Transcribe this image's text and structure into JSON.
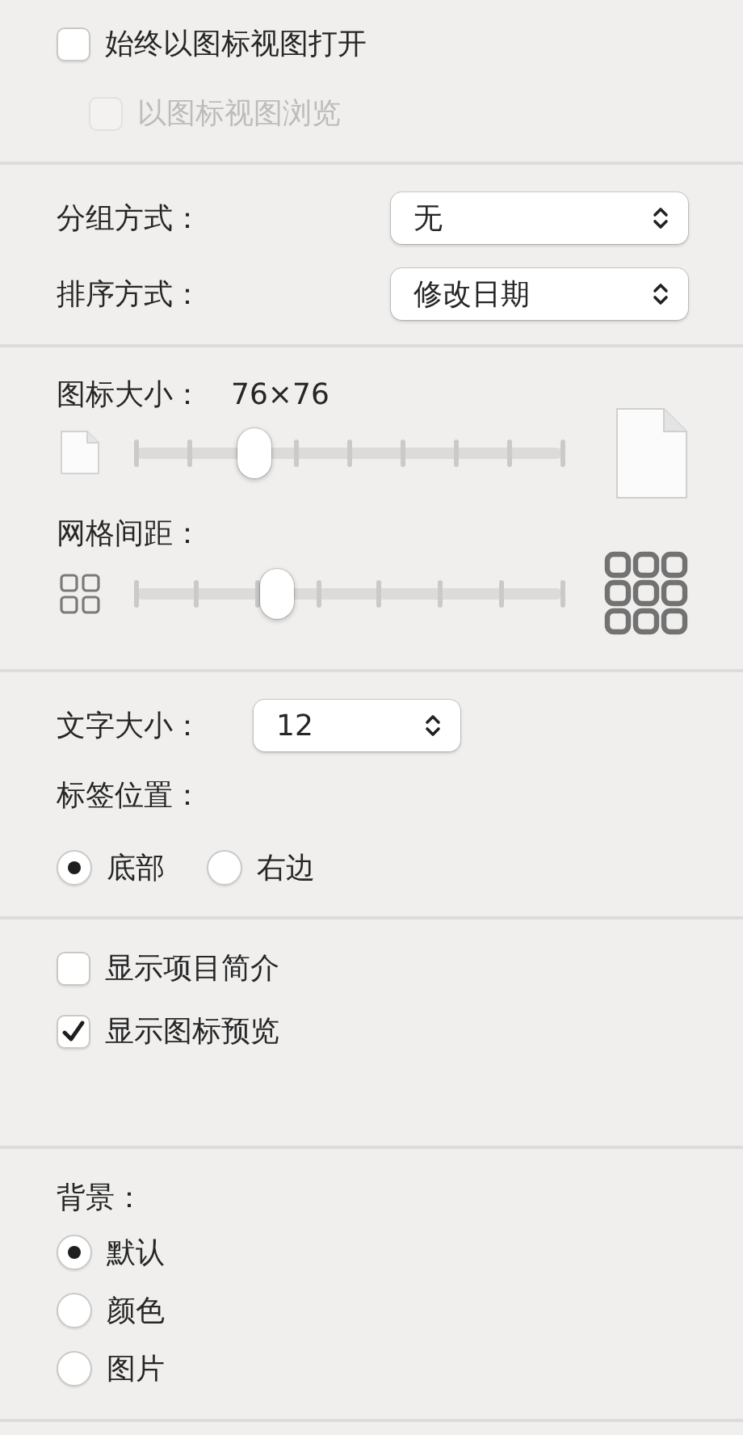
{
  "view_mode": [
    {
      "label": "始终以图标视图打开",
      "checked": false,
      "disabled": false
    },
    {
      "label": "以图标视图浏览",
      "checked": false,
      "disabled": true
    }
  ],
  "arrange": [
    {
      "label": "分组方式：",
      "value": "无"
    },
    {
      "label": "排序方式：",
      "value": "修改日期"
    }
  ],
  "icon_size": {
    "label": "图标大小：",
    "reading": "76×76",
    "level": 0.28
  },
  "grid_spacing": {
    "label": "网格间距：",
    "level": 0.33
  },
  "text_size": {
    "label": "文字大小：",
    "value": "12"
  },
  "label_position": {
    "label": "标签位置：",
    "options": [
      {
        "label": "底部",
        "selected": true
      },
      {
        "label": "右边",
        "selected": false
      }
    ]
  },
  "show_options": [
    {
      "label": "显示项目简介",
      "checked": false,
      "disabled": false
    },
    {
      "label": "显示图标预览",
      "checked": true,
      "disabled": false
    }
  ],
  "background": {
    "label": "背景：",
    "options": [
      {
        "label": "默认",
        "selected": true
      },
      {
        "label": "颜色",
        "selected": false
      },
      {
        "label": "图片",
        "selected": false
      }
    ]
  }
}
